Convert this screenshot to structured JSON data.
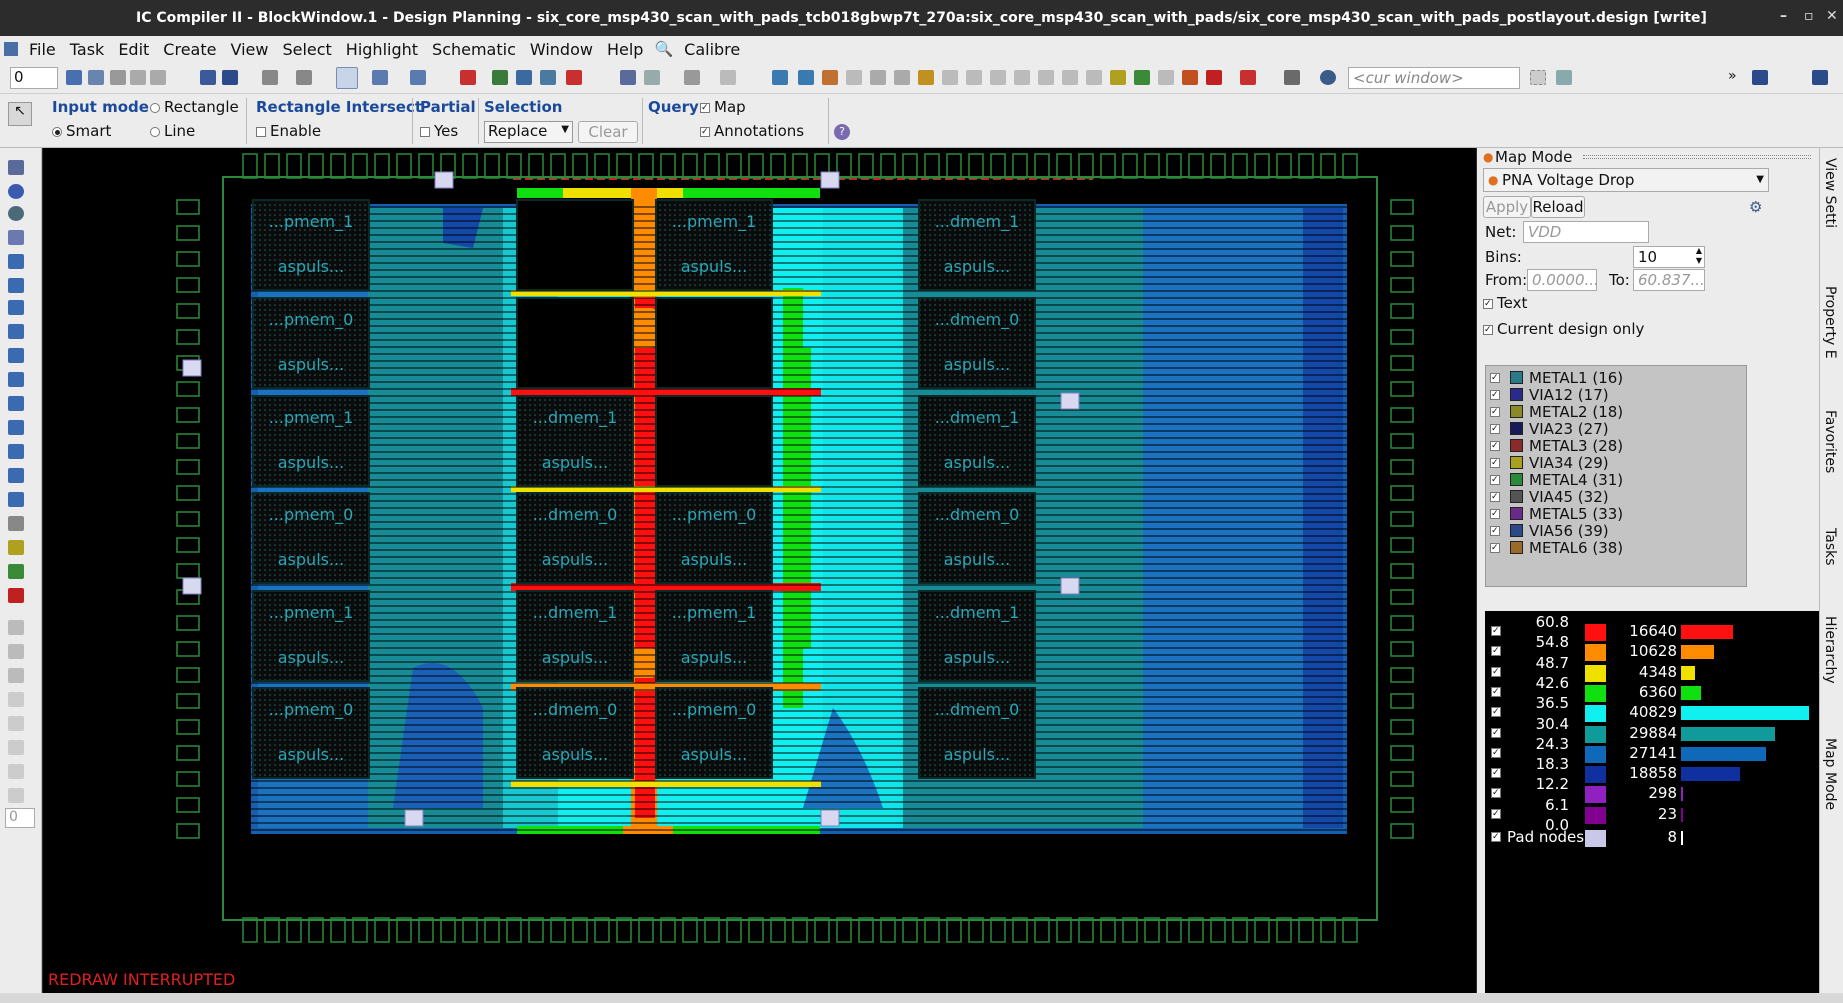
{
  "title": "IC Compiler II - BlockWindow.1 - Design Planning - six_core_msp430_scan_with_pads_tcb018gbwp7t_270a:six_core_msp430_scan_with_pads/six_core_msp430_scan_with_pads_postlayout.design [write]",
  "menu": [
    "File",
    "Task",
    "Edit",
    "Create",
    "View",
    "Select",
    "Highlight",
    "Schematic",
    "Window",
    "Help",
    "Calibre"
  ],
  "toolbar": {
    "spin_value": "0",
    "cur_window_placeholder": "<cur window>"
  },
  "options": {
    "input_mode_label": "Input mode",
    "rectangle": "Rectangle",
    "smart": "Smart",
    "line": "Line",
    "rect_intersect_label": "Rectangle Intersect",
    "enable": "Enable",
    "partial_label": "Partial",
    "yes": "Yes",
    "selection_label": "Selection",
    "selection_value": "Replace",
    "clear": "Clear",
    "query_label": "Query",
    "map": "Map",
    "annotations": "Annotations"
  },
  "lefttools": {
    "spin_value": "0"
  },
  "canvas": {
    "status": "REDRAW INTERRUPTED",
    "cells": [
      {
        "name": "...pmem_1",
        "sub": "aspuls..."
      },
      {
        "name": "...pmem_0",
        "sub": "aspuls..."
      },
      {
        "name": "...pmem_1",
        "sub": "aspuls..."
      },
      {
        "name": "...pmem_0",
        "sub": "aspuls..."
      },
      {
        "name": "...pmem_1",
        "sub": "aspuls..."
      },
      {
        "name": "...pmem_0",
        "sub": "aspuls..."
      },
      {
        "name": "...dmem_1",
        "sub": "aspuls..."
      },
      {
        "name": "...dmem_0",
        "sub": "aspuls..."
      },
      {
        "name": "...dmem_1",
        "sub": "aspuls..."
      },
      {
        "name": "...dmem_0",
        "sub": "aspuls..."
      },
      {
        "name": "...pmem_1",
        "sub": "aspuls..."
      },
      {
        "name": "...pmem_0",
        "sub": "aspuls..."
      },
      {
        "name": "...pmem_1",
        "sub": "aspuls..."
      },
      {
        "name": "...pmem_0",
        "sub": "aspuls..."
      },
      {
        "name": "...dmem_1",
        "sub": "aspuls..."
      },
      {
        "name": "...dmem_0",
        "sub": "aspuls..."
      },
      {
        "name": "...dmem_1",
        "sub": "aspuls..."
      },
      {
        "name": "...dmem_0",
        "sub": "aspuls..."
      },
      {
        "name": "...dmem_1",
        "sub": "aspuls..."
      },
      {
        "name": "...dmem_0",
        "sub": "aspuls..."
      }
    ]
  },
  "panel": {
    "header": "Map Mode",
    "mode": "PNA Voltage Drop",
    "apply": "Apply",
    "reload": "Reload",
    "net_label": "Net:",
    "net_placeholder": "VDD",
    "bins_label": "Bins:",
    "bins_value": "10",
    "from_label": "From:",
    "from_value": "0.0000...",
    "to_label": "To:",
    "to_value": "60.837...",
    "text_cb": "Text",
    "current_design_cb": "Current design only",
    "layers": [
      {
        "name": "METAL1 (16)",
        "color": "#2a7a8a"
      },
      {
        "name": "VIA12 (17)",
        "color": "#2a2a8a"
      },
      {
        "name": "METAL2 (18)",
        "color": "#8a8a2a"
      },
      {
        "name": "VIA23 (27)",
        "color": "#1a1a5a"
      },
      {
        "name": "METAL3 (28)",
        "color": "#8a2a2a"
      },
      {
        "name": "VIA34 (29)",
        "color": "#aaa020"
      },
      {
        "name": "METAL4 (31)",
        "color": "#2a8a3a"
      },
      {
        "name": "VIA45 (32)",
        "color": "#555555"
      },
      {
        "name": "METAL5 (33)",
        "color": "#6a2a8a"
      },
      {
        "name": "VIA56 (39)",
        "color": "#2a4a8a"
      },
      {
        "name": "METAL6 (38)",
        "color": "#9a6a2a"
      }
    ],
    "histogram": {
      "limits": [
        "60.8",
        "54.8",
        "48.7",
        "42.6",
        "36.5",
        "30.4",
        "24.3",
        "18.3",
        "12.2",
        "6.1",
        "0.0"
      ],
      "bins": [
        {
          "count": "16640",
          "value": 16640,
          "color": "#ff1010"
        },
        {
          "count": "10628",
          "value": 10628,
          "color": "#ff8c00"
        },
        {
          "count": "4348",
          "value": 4348,
          "color": "#f0e000"
        },
        {
          "count": "6360",
          "value": 6360,
          "color": "#10e010"
        },
        {
          "count": "40829",
          "value": 40829,
          "color": "#10f0f0"
        },
        {
          "count": "29884",
          "value": 29884,
          "color": "#109a9a"
        },
        {
          "count": "27141",
          "value": 27141,
          "color": "#1068b8"
        },
        {
          "count": "18858",
          "value": 18858,
          "color": "#1030a0"
        },
        {
          "count": "298",
          "value": 298,
          "color": "#9020c0"
        },
        {
          "count": "23",
          "value": 23,
          "color": "#800090"
        }
      ],
      "pad_label": "Pad nodes",
      "pad_count": "8"
    }
  },
  "sidetabs": [
    "View Setti",
    "Property E",
    "Favorites",
    "Tasks",
    "Hierarchy",
    "Map Mode"
  ]
}
